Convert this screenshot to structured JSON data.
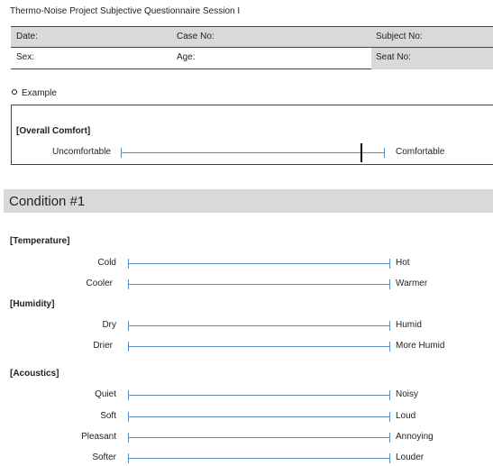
{
  "header": {
    "title": "Thermo-Noise Project Subjective Questionnaire Session I"
  },
  "info_table": {
    "date_label": "Date:",
    "case_label": "Case No:",
    "subject_label": "Subject No:",
    "sex_label": "Sex:",
    "age_label": "Age:",
    "seat_label": "Seat No:"
  },
  "example": {
    "label": "Example",
    "heading": "[Overall Comfort]",
    "left": "Uncomfortable",
    "right": "Comfortable",
    "marked_fraction": 0.91
  },
  "condition": {
    "title": "Condition #1"
  },
  "sections": [
    {
      "heading": "[Temperature]",
      "scales": [
        {
          "left": "Cold",
          "right": "Hot"
        },
        {
          "left": "Cooler",
          "right": "Warmer"
        }
      ]
    },
    {
      "heading": "[Humidity]",
      "scales": [
        {
          "left": "Dry",
          "right": "Humid"
        },
        {
          "left": "Drier",
          "right": "More Humid"
        }
      ]
    },
    {
      "heading": "[Acoustics]",
      "scales": [
        {
          "left": "Quiet",
          "right": "Noisy"
        },
        {
          "left": "Soft",
          "right": "Loud"
        },
        {
          "left": "Pleasant",
          "right": "Annoying"
        },
        {
          "left": "Softer",
          "right": "Louder"
        }
      ]
    }
  ],
  "colors": {
    "scale_line": "#5b8fbd",
    "shade": "#d9d9d9"
  }
}
